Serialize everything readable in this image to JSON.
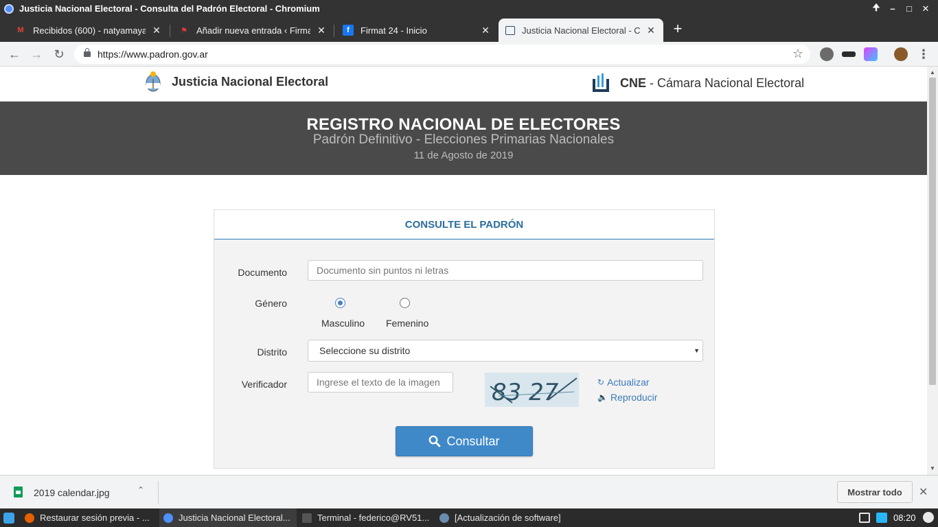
{
  "window": {
    "title": "Justicia Nacional Electoral - Consulta del Padrón Electoral - Chromium"
  },
  "tabs": [
    {
      "label": "Recibidos (600) - natyamayada"
    },
    {
      "label": "Añadir nueva entrada ‹ Firmat"
    },
    {
      "label": "Firmat 24 - Inicio"
    },
    {
      "label": "Justicia Nacional Electoral - Co"
    }
  ],
  "address_bar": {
    "url": "https://www.padron.gov.ar"
  },
  "site": {
    "brand_left": "Justicia Nacional Electoral",
    "brand_right_bold": "CNE",
    "brand_right_rest": " - Cámara Nacional Electoral",
    "banner_title": "REGISTRO NACIONAL DE ELECTORES",
    "banner_subtitle": "Padrón Definitivo - Elecciones Primarias Nacionales",
    "banner_date": "11 de Agosto de 2019"
  },
  "form": {
    "heading": "CONSULTE EL PADRÓN",
    "documento_label": "Documento",
    "documento_placeholder": "Documento sin puntos ni letras",
    "genero_label": "Género",
    "genero_options": [
      "Masculino",
      "Femenino"
    ],
    "genero_selected": "Masculino",
    "distrito_label": "Distrito",
    "distrito_value": "Seleccione su distrito",
    "verificador_label": "Verificador",
    "verificador_placeholder": "Ingrese el texto de la imagen",
    "captcha_text": "83 27",
    "actualizar": "Actualizar",
    "reproducir": "Reproducir",
    "submit": "Consultar"
  },
  "downloads": {
    "file": "2019 calendar.jpg",
    "show_all": "Mostrar todo"
  },
  "taskbar": {
    "items": [
      "Restaurar sesión previa - ...",
      "Justicia Nacional Electoral...",
      "Terminal - federico@RV51...",
      "[Actualización de software]"
    ],
    "clock": "08:20"
  },
  "colors": {
    "banner": "#4a4a4a",
    "panel_heading": "#2b6d9b",
    "button": "#3f89c9",
    "link": "#3a7ab8"
  }
}
